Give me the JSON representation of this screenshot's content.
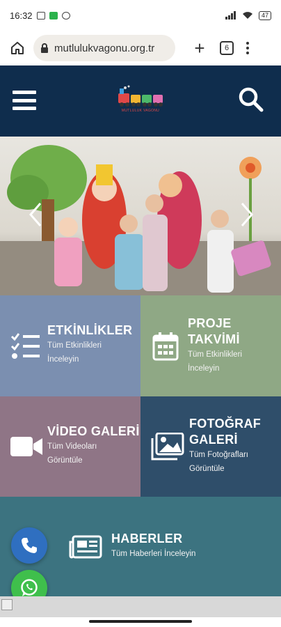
{
  "status_bar": {
    "time": "16:32",
    "battery": "47"
  },
  "browser": {
    "url": "mutlulukvagonu.org.tr",
    "tab_count": "6"
  },
  "header": {
    "logo_text": "MUTLULUK VAGONU"
  },
  "tiles": {
    "etkinlikler": {
      "title": "ETKİNLİKLER",
      "sub1": "Tüm Etkinlikleri",
      "sub2": "İnceleyin"
    },
    "proje": {
      "title1": "PROJE",
      "title2": "TAKVİMİ",
      "sub1": "Tüm Etkinlikleri",
      "sub2": "İnceleyin"
    },
    "video": {
      "title": "VİDEO GALERİ",
      "sub1": "Tüm Videoları",
      "sub2": "Görüntüle"
    },
    "foto": {
      "title1": "FOTOĞRAF",
      "title2": "GALERİ",
      "sub1": "Tüm Fotoğrafları",
      "sub2": "Görüntüle"
    },
    "haberler": {
      "title": "HABERLER",
      "sub": "Tüm Haberleri İnceleyin"
    }
  },
  "colors": {
    "header_bg": "#0f2d4d",
    "etkinlikler_bg": "#7b8fb0",
    "proje_bg": "#8fa885",
    "video_bg": "#8f7586",
    "foto_bg": "#2f4e6a",
    "haberler_bg": "#3c7380",
    "phone_btn": "#2f6fc0",
    "whatsapp_btn": "#3fbf4c"
  }
}
